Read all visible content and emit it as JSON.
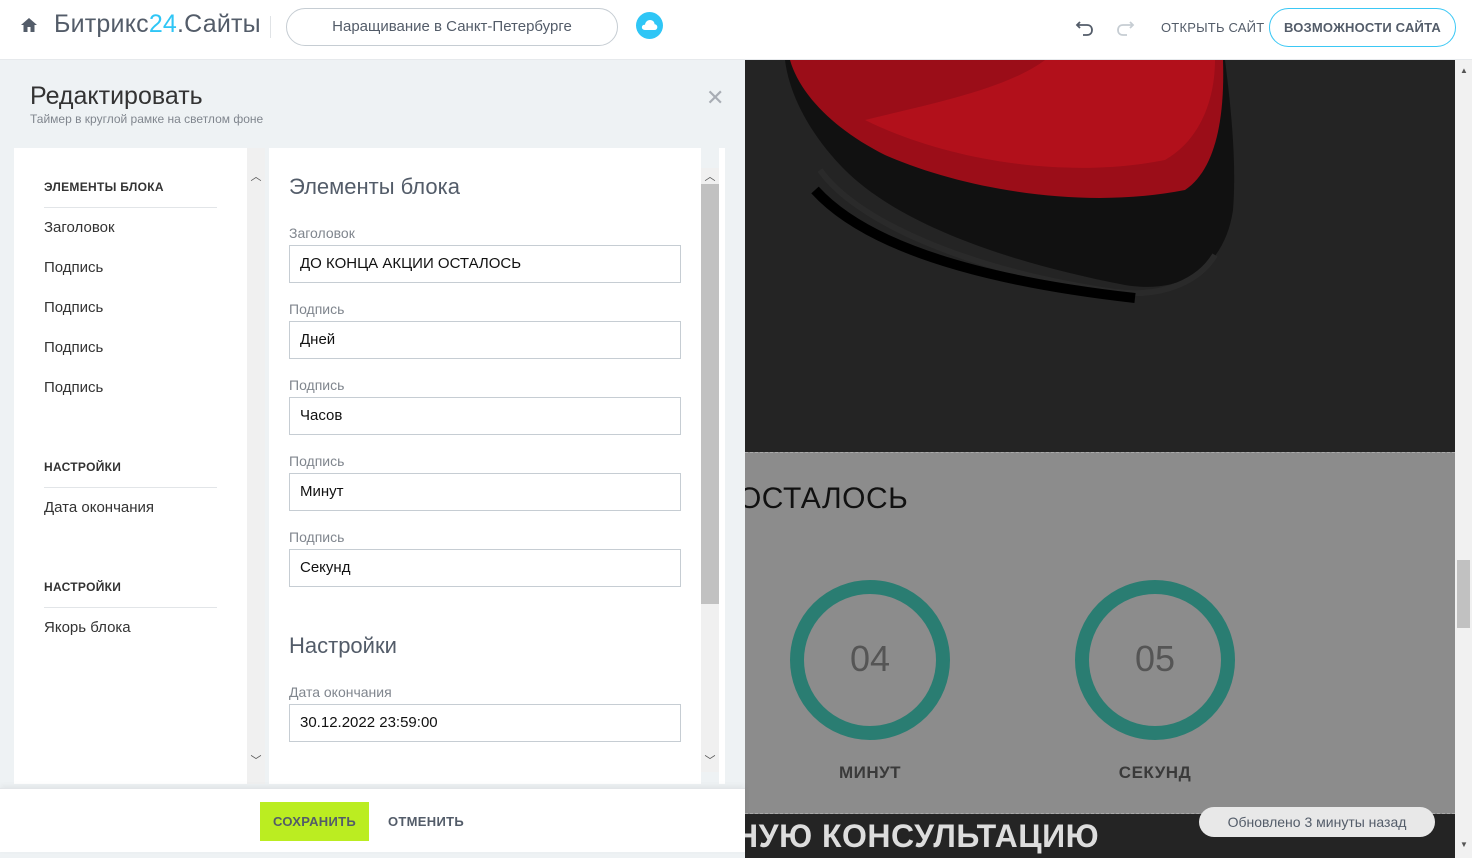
{
  "header": {
    "brand_main": "Битрикс",
    "brand_num": "24",
    "brand_suffix": ".Сайты",
    "site_name": "Наращивание в Санкт-Петербурге",
    "open_site": "ОТКРЫТЬ САЙТ",
    "features": "ВОЗМОЖНОСТИ САЙТА"
  },
  "editor": {
    "title": "Редактировать",
    "subtitle": "Таймер в круглой рамке на светлом фоне",
    "nav": {
      "section1": "ЭЛЕМЕНТЫ БЛОКА",
      "items1": [
        "Заголовок",
        "Подпись",
        "Подпись",
        "Подпись",
        "Подпись"
      ],
      "section2": "НАСТРОЙКИ",
      "items2": [
        "Дата окончания"
      ],
      "section3": "НАСТРОЙКИ",
      "items3": [
        "Якорь блока"
      ]
    },
    "form": {
      "elements_heading": "Элементы блока",
      "fields": [
        {
          "label": "Заголовок",
          "value": "ДО КОНЦА АКЦИИ ОСТАЛОСЬ"
        },
        {
          "label": "Подпись",
          "value": "Дней"
        },
        {
          "label": "Подпись",
          "value": "Часов"
        },
        {
          "label": "Подпись",
          "value": "Минут"
        },
        {
          "label": "Подпись",
          "value": "Секунд"
        }
      ],
      "settings_heading": "Настройки",
      "end_date_label": "Дата окончания",
      "end_date_value": "30.12.2022 23:59:00"
    },
    "footer": {
      "save": "СОХРАНИТЬ",
      "cancel": "ОТМЕНИТЬ"
    }
  },
  "preview": {
    "heading_fragment": "ИИ ОСТАЛОСЬ",
    "timers": [
      {
        "value": "04",
        "label": "МИНУТ"
      },
      {
        "value": "05",
        "label": "СЕКУНД"
      }
    ],
    "bottom_fragment": "ТНУЮ КОНСУЛЬТАЦИЮ",
    "updated": "Обновлено 3 минуты назад"
  },
  "colors": {
    "accent": "#2fc6f6",
    "save_green": "#bbed21",
    "timer_ring": "#2a7d72"
  }
}
